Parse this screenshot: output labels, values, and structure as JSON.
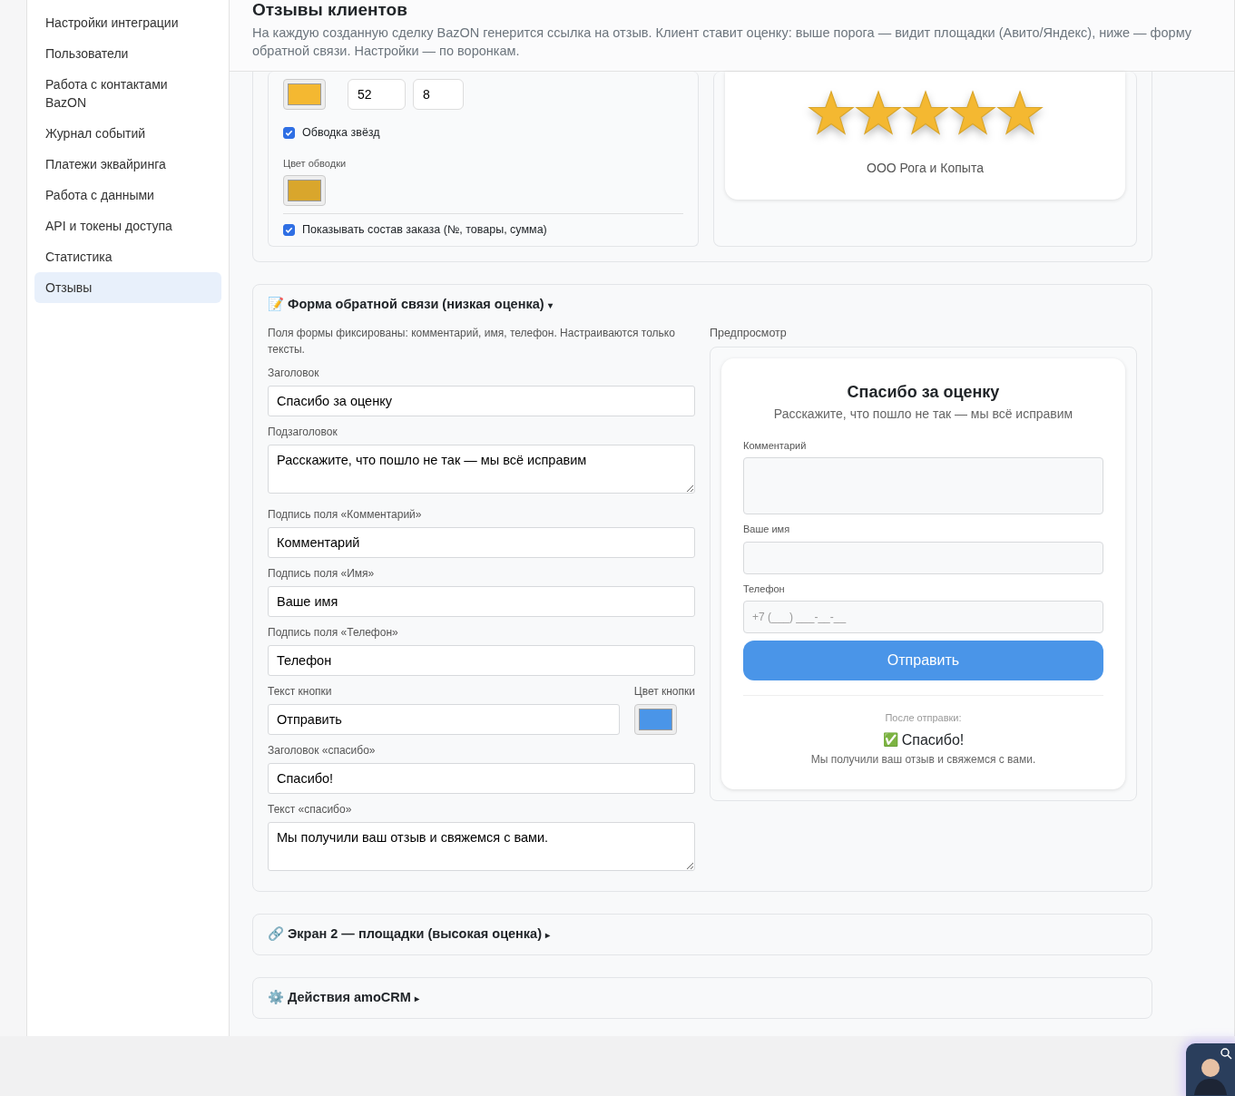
{
  "sidebar": {
    "items": [
      {
        "label": "Настройки интеграции",
        "selected": false
      },
      {
        "label": "Пользователи",
        "selected": false
      },
      {
        "label": "Работа с контактами BazON",
        "selected": false
      },
      {
        "label": "Журнал событий",
        "selected": false
      },
      {
        "label": "Платежи эквайринга",
        "selected": false
      },
      {
        "label": "Работа с данными",
        "selected": false
      },
      {
        "label": "API и токены доступа",
        "selected": false
      },
      {
        "label": "Статистика",
        "selected": false
      },
      {
        "label": "Отзывы",
        "selected": true
      }
    ]
  },
  "header": {
    "title": "Отзывы клиентов",
    "description": "На каждую созданную сделку BazON генерится ссылка на отзыв. Клиент ставит оценку: выше порога — видит площадки (Авито/Яндекс), ниже — форму обратной связи. Настройки — по воронкам."
  },
  "appearance": {
    "star_swatch": {
      "color": "#f4b831"
    },
    "size": "52",
    "shadow": "8",
    "outline": {
      "label": "Обводка звёзд",
      "checked": true
    },
    "outline_color_label": "Цвет обводки",
    "outline_swatch": {
      "color": "#d9a62c"
    },
    "show_order": {
      "label": "Показывать состав заказа (№, товары, сумма)",
      "checked": true
    }
  },
  "rating_preview": {
    "stars": 5,
    "company": "ООО Рога и Копыта"
  },
  "sections": [
    {
      "icon": "📝",
      "title": "Форма обратной связи (низкая оценка)",
      "caret": "▾",
      "expanded": true,
      "note": "Поля формы фиксированы: комментарий, имя, телефон. Настраиваются только тексты.",
      "fields": [
        {
          "kind": "input",
          "label": "Заголовок",
          "value": "Спасибо за оценку"
        },
        {
          "kind": "textarea",
          "label": "Подзаголовок",
          "value": "Расскажите, что пошло не так — мы всё исправим"
        },
        {
          "kind": "input",
          "label": "Подпись поля «Комментарий»",
          "value": "Комментарий"
        },
        {
          "kind": "input",
          "label": "Подпись поля «Имя»",
          "value": "Ваше имя"
        },
        {
          "kind": "input",
          "label": "Подпись поля «Телефон»",
          "value": "Телефон"
        },
        {
          "kind": "button",
          "label": "Текст кнопки",
          "value": "Отправить",
          "color_label": "Цвет кнопки",
          "swatch": {
            "color": "#4a95e8"
          }
        },
        {
          "kind": "input",
          "label": "Заголовок «спасибо»",
          "value": "Спасибо!"
        },
        {
          "kind": "textarea",
          "label": "Текст «спасибо»",
          "value": "Мы получили ваш отзыв и свяжемся с вами."
        }
      ],
      "preview": {
        "label": "Предпросмотр",
        "title": "Спасибо за оценку",
        "subtitle": "Расскажите, что пошло не так — мы всё исправим",
        "fields": [
          {
            "kind": "textarea",
            "label": "Комментарий"
          },
          {
            "kind": "input",
            "label": "Ваше имя"
          },
          {
            "kind": "input",
            "label": "Телефон",
            "placeholder": "+7 (___) ___-__-__"
          }
        ],
        "button": {
          "label": "Отправить",
          "color": "#4a95e8"
        },
        "after_label": "После отправки:",
        "thanks_icon": "✅",
        "thanks_title": "Спасибо!",
        "thanks_text": "Мы получили ваш отзыв и свяжемся с вами."
      }
    },
    {
      "icon": "🔗",
      "title": "Экран 2 — площадки (высокая оценка)",
      "caret": "▸",
      "expanded": false
    },
    {
      "icon": "⚙️",
      "title": "Действия amoCRM",
      "caret": "▸",
      "expanded": false
    }
  ]
}
